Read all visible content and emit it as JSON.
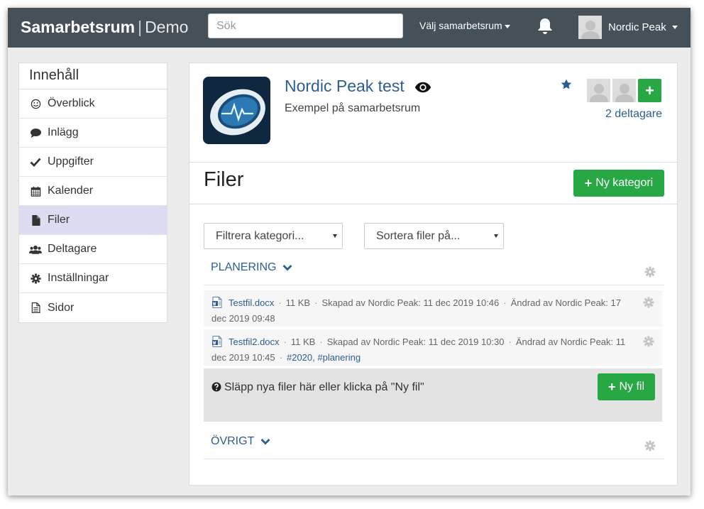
{
  "header": {
    "brand_main": "Samarbetsrum",
    "brand_sep": "|",
    "brand_sub": "Demo",
    "search_placeholder": "Sök",
    "workspace_select_label": "Välj samarbetsrum",
    "user_name": "Nordic Peak"
  },
  "sidebar": {
    "title": "Innehåll",
    "items": [
      {
        "label": "Överblick",
        "icon": "smile-icon"
      },
      {
        "label": "Inlägg",
        "icon": "comment-icon"
      },
      {
        "label": "Uppgifter",
        "icon": "check-icon"
      },
      {
        "label": "Kalender",
        "icon": "calendar-icon"
      },
      {
        "label": "Filer",
        "icon": "file-icon",
        "active": true
      },
      {
        "label": "Deltagare",
        "icon": "users-icon"
      },
      {
        "label": "Inställningar",
        "icon": "cog-icon"
      },
      {
        "label": "Sidor",
        "icon": "document-icon"
      }
    ]
  },
  "workspace": {
    "title": "Nordic Peak test",
    "description": "Exempel på samarbetsrum",
    "member_count_label": "2 deltagare",
    "add_member_label": "+"
  },
  "files_page": {
    "title": "Filer",
    "new_category_label": "Ny kategori",
    "filter_placeholder": "Filtrera kategori...",
    "sort_placeholder": "Sortera filer på...",
    "categories": [
      {
        "name": "PLANERING",
        "files": [
          {
            "name": "Testfil.docx",
            "size": "11 KB",
            "created": "Skapad av Nordic Peak: 11 dec 2019 10:46",
            "modified": "Ändrad av Nordic Peak: 17 dec 2019 09:48",
            "tags": ""
          },
          {
            "name": "Testfil2.docx",
            "size": "11 KB",
            "created": "Skapad av Nordic Peak: 11 dec 2019 10:30",
            "modified": "Ändrad av Nordic Peak: 11 dec 2019 10:45",
            "tags": "#2020, #planering"
          }
        ]
      },
      {
        "name": "ÖVRIGT",
        "files": []
      }
    ],
    "dropzone_text": "Släpp nya filer här eller klicka på \"Ny fil\"",
    "new_file_label": "Ny fil"
  },
  "colors": {
    "topbar": "#465058",
    "accent_blue": "#2c5e93",
    "green": "#28a745",
    "active_item": "#dcdcf2"
  }
}
